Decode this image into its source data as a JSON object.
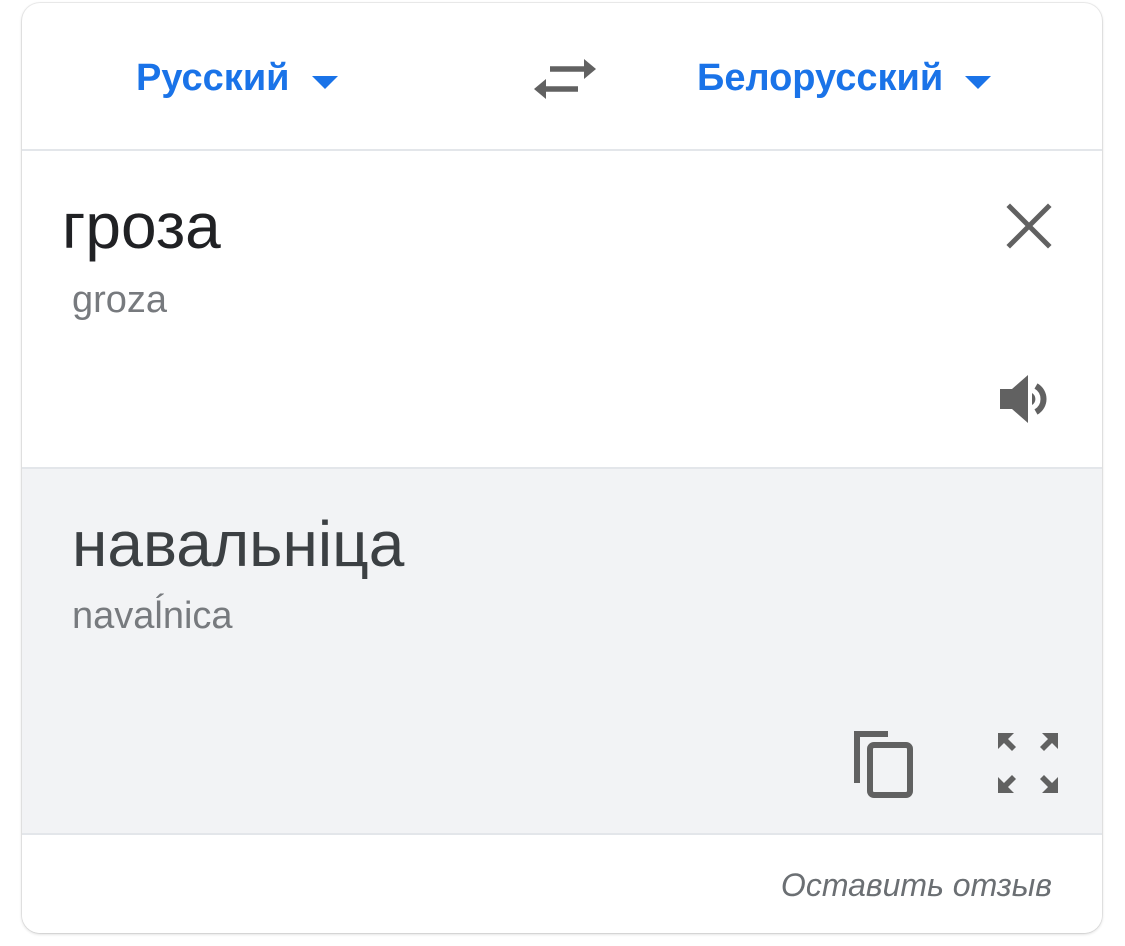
{
  "header": {
    "source_language": "Русский",
    "target_language": "Белорусский"
  },
  "source": {
    "text": "гроза",
    "transliteration": "groza"
  },
  "result": {
    "text": "навальніца",
    "transliteration": "navaĺnica"
  },
  "footer": {
    "feedback_label": "Оставить отзыв"
  },
  "icons": {
    "swap": "swap-arrows-icon",
    "clear": "close-icon",
    "speaker": "speaker-icon",
    "copy": "copy-icon",
    "fullscreen": "fullscreen-icon"
  },
  "colors": {
    "accent": "#1a73e8",
    "icon": "#616161",
    "result_background": "#f2f3f5"
  }
}
